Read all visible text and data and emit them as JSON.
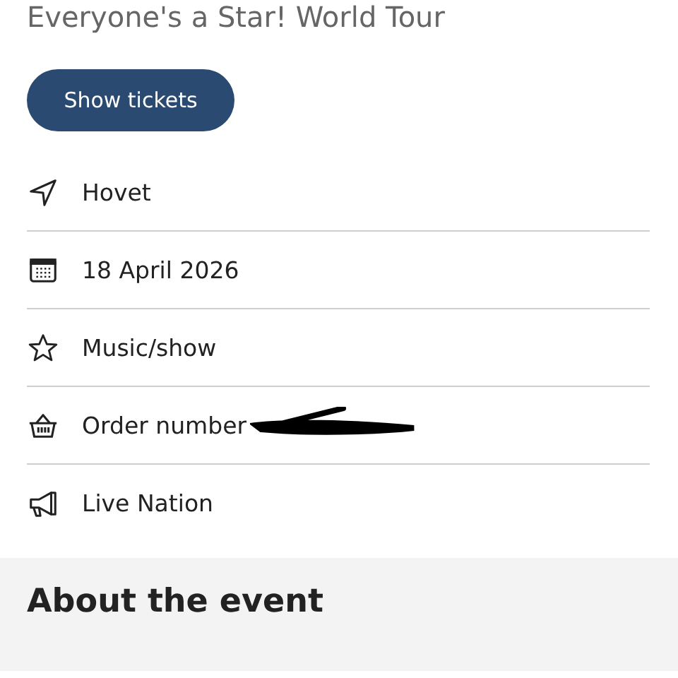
{
  "title": "Everyone's a Star! World Tour",
  "button": "Show tickets",
  "details": [
    {
      "kind": "location",
      "text": "Hovet",
      "redacted": false
    },
    {
      "kind": "calendar",
      "text": "18 April 2026",
      "redacted": false
    },
    {
      "kind": "star",
      "text": "Music/show",
      "redacted": false
    },
    {
      "kind": "basket",
      "text": "Order number",
      "redacted": true
    },
    {
      "kind": "megaphone",
      "text": "Live Nation",
      "redacted": false
    }
  ],
  "section_title": "About the event"
}
